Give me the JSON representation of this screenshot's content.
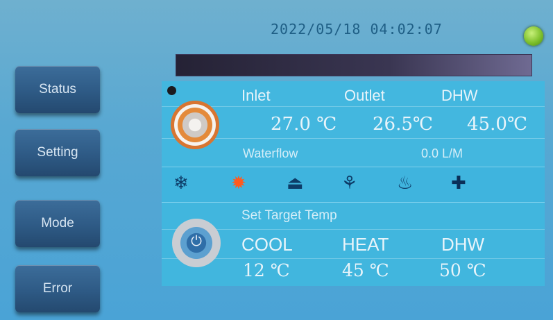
{
  "header": {
    "datetime": "2022/05/18 04:02:07"
  },
  "status_led": {
    "color": "#7fc12d",
    "state": "on"
  },
  "progress": {
    "fraction": 1.0
  },
  "sidebar": {
    "items": [
      {
        "label": "Status"
      },
      {
        "label": "Setting"
      },
      {
        "label": "Mode"
      },
      {
        "label": "Error"
      }
    ]
  },
  "readings": {
    "inlet_label": "Inlet",
    "outlet_label": "Outlet",
    "dhw_label": "DHW",
    "inlet_value": "27.0 ℃",
    "outlet_value": "26.5℃",
    "dhw_value": "45.0℃",
    "waterflow_label": "Waterflow",
    "waterflow_value": "0.0 L/M"
  },
  "mode_icons": [
    {
      "name": "snowflake-icon",
      "glyph": "❄"
    },
    {
      "name": "sun-icon",
      "glyph": "✹"
    },
    {
      "name": "shower-icon",
      "glyph": "⏏"
    },
    {
      "name": "defrost-icon",
      "glyph": "⚘"
    },
    {
      "name": "heating-icon",
      "glyph": "♨"
    },
    {
      "name": "plus-icon",
      "glyph": "✚"
    }
  ],
  "target": {
    "title": "Set Target Temp",
    "cool_label": "COOL",
    "heat_label": "HEAT",
    "dhw_label": "DHW",
    "cool_value": "12 ℃",
    "heat_value": "45 ℃",
    "dhw_value": "50 ℃"
  }
}
